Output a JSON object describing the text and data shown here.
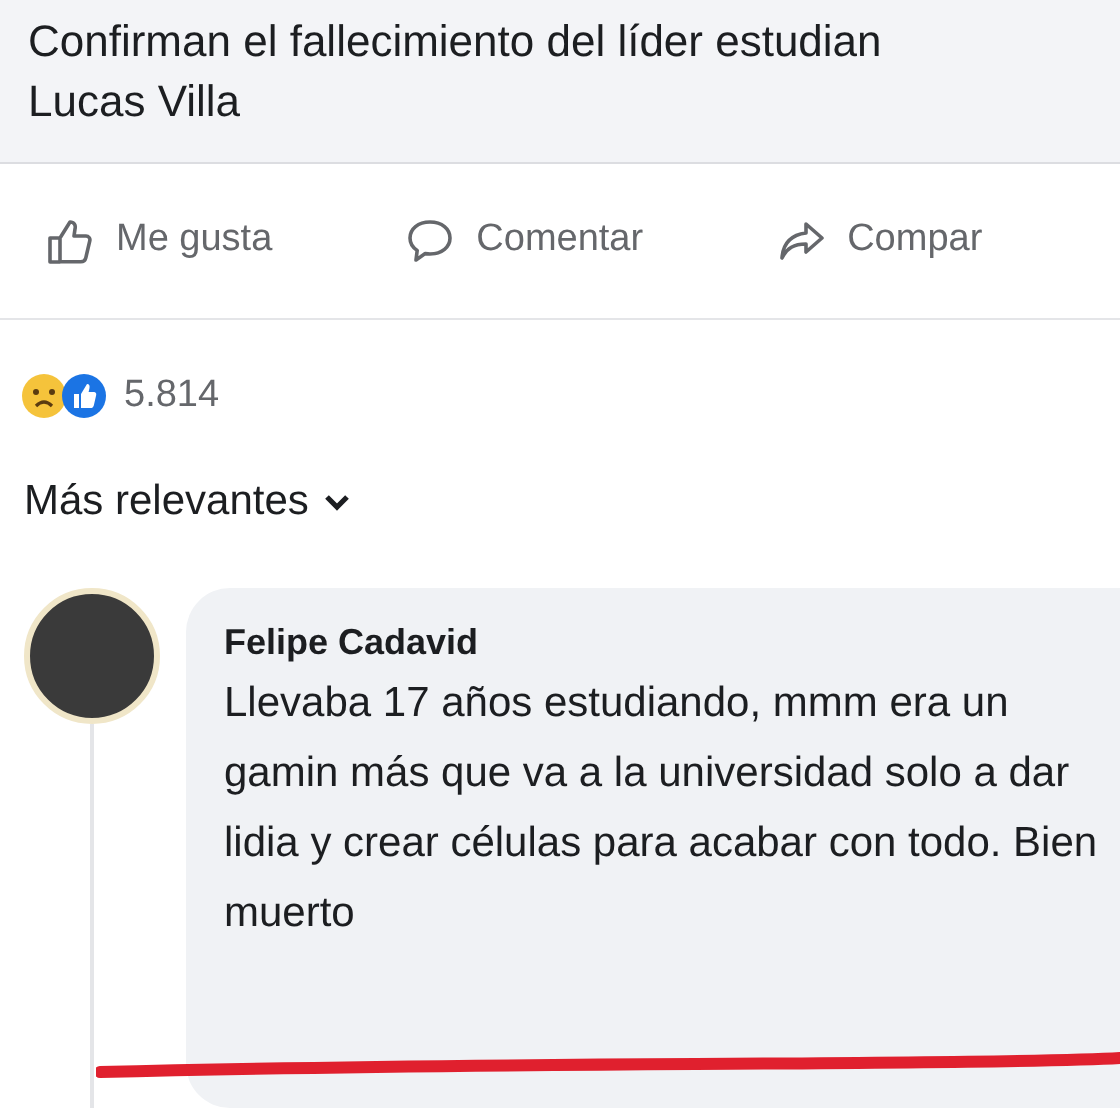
{
  "post": {
    "title_lines": [
      "Confirman el fallecimiento del líder estudian",
      "Lucas Villa"
    ]
  },
  "actions": [
    {
      "kind": "like",
      "label": "Me gusta"
    },
    {
      "kind": "comment",
      "label": "Comentar"
    },
    {
      "kind": "share",
      "label": "Compar"
    }
  ],
  "reactions": {
    "count": "5.814"
  },
  "sort": {
    "label": "Más relevantes"
  },
  "comments": [
    {
      "author": "Felipe Cadavid",
      "text": "Llevaba 17 años estudiando, mmm era un gamin más que va a la universidad solo a dar lidia y crear células para acabar con todo. Bien muerto"
    }
  ]
}
